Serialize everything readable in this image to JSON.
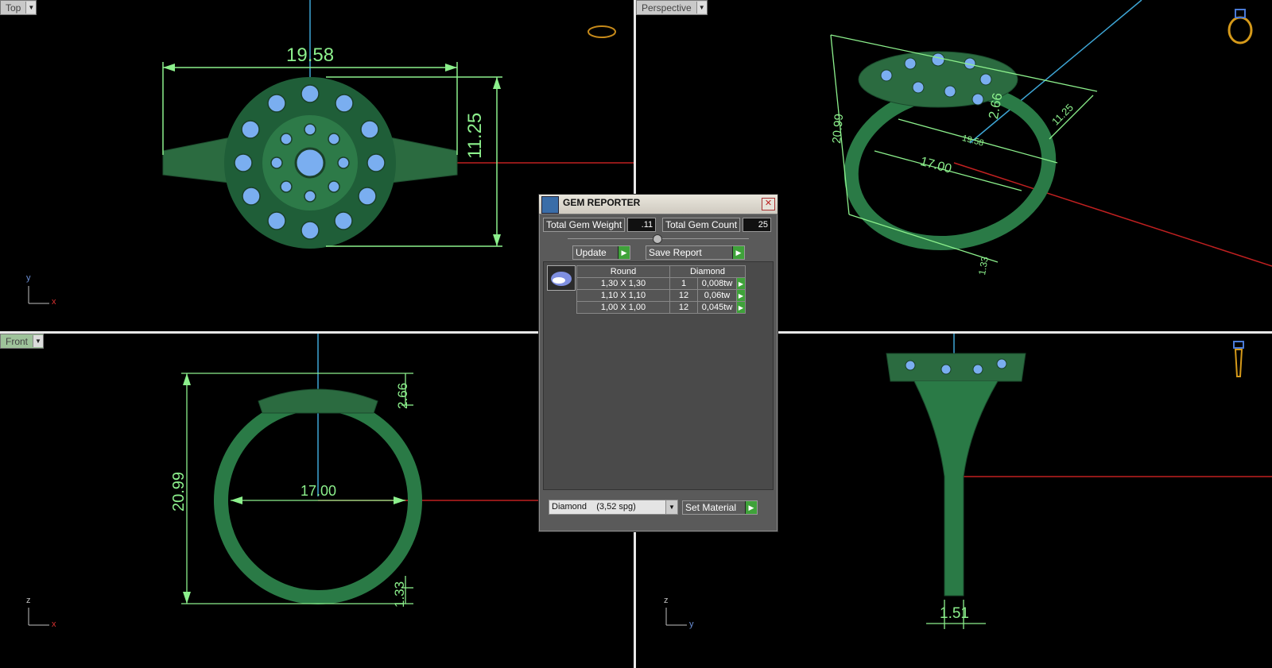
{
  "viewports": {
    "top": {
      "label": "Top",
      "dim_width": "19.58",
      "dim_height": "11.25",
      "axis_a": "y",
      "axis_b": "x"
    },
    "perspective": {
      "label": "Perspective",
      "dim_height": "20.99",
      "dim_depth": "2.66",
      "dim_len": "11.25",
      "dim_width": "19.58",
      "dim_inner": "17.00",
      "dim_band": "1.33"
    },
    "front": {
      "label": "Front",
      "dim_height": "20.99",
      "dim_top": "2.66",
      "dim_inner": "17.00",
      "dim_band": "1.33",
      "axis_a": "z",
      "axis_b": "x"
    },
    "right": {
      "dim_band": "1.51",
      "axis_a": "z",
      "axis_b": "y"
    }
  },
  "gem_reporter": {
    "title": "GEM REPORTER",
    "total_weight_label": "Total Gem Weight",
    "total_weight_value": ".11",
    "total_count_label": "Total Gem Count",
    "total_count_value": "25",
    "update_label": "Update",
    "save_report_label": "Save Report",
    "header_shape": "Round",
    "header_material": "Diamond",
    "rows": [
      {
        "size": "1,30 X 1,30",
        "count": "1",
        "weight": "0,008tw"
      },
      {
        "size": "1,10 X 1,10",
        "count": "12",
        "weight": "0,06tw"
      },
      {
        "size": "1,00 X 1,00",
        "count": "12",
        "weight": "0,045tw"
      }
    ],
    "material_select": "Diamond    (3,52 spg)",
    "set_material_label": "Set Material"
  },
  "colors": {
    "ring_green": "#2e7d4a",
    "gem_blue": "#7aaef0",
    "dim_green": "#8cf08c",
    "axis_red": "#c02020",
    "axis_cyan": "#3ea6d6"
  }
}
